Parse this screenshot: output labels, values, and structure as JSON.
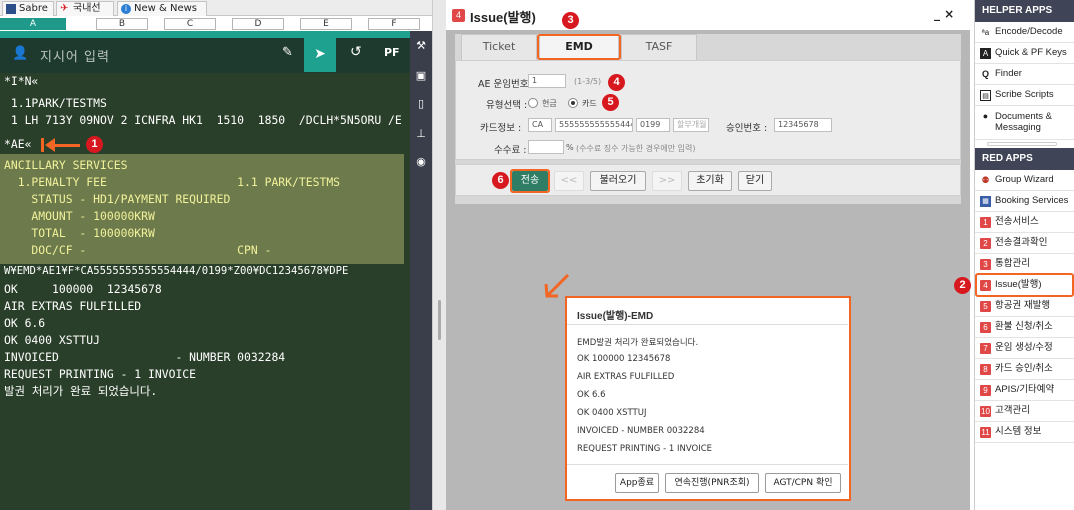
{
  "left": {
    "tabs": [
      "Sabre",
      "국내선",
      "New & News"
    ],
    "areas": [
      "A",
      "B",
      "C",
      "D",
      "E",
      "F"
    ],
    "command_placeholder": "지시어 입력",
    "pf_label": "PF",
    "lines": [
      "*I*N«",
      " 1.1PARK/TESTMS",
      " 1 LH 713Y 09NOV 2 ICNFRA HK1  1510  1850  /DCLH*5N5ORU /E",
      "*AE«"
    ],
    "highlight_lines": [
      "ANCILLARY SERVICES",
      "  1.PENALTY FEE                   1.1 PARK/TESTMS",
      "    STATUS - HD1/PAYMENT REQUIRED",
      "    AMOUNT - 100000KRW",
      "    TOTAL  - 100000KRW",
      "    DOC/CF -                      CPN -"
    ],
    "lower_lines": [
      "W¥EMD*AE1¥F*CA5555555555554444/0199*Z00¥DC12345678¥DPE",
      "OK     100000  12345678",
      "AIR EXTRAS FULFILLED",
      "OK 6.6",
      "OK 0400 XSTTUJ",
      "INVOICED                 - NUMBER 0032284",
      "REQUEST PRINTING - 1 INVOICE",
      "발권 처리가 완료 되었습니다."
    ]
  },
  "mid": {
    "title_num": "4",
    "title": "Issue(발행)",
    "close": "_ ×",
    "tabs": [
      "Ticket",
      "EMD",
      "TASF"
    ],
    "ae_label": "AE 운임번호 :",
    "ae_value": "1",
    "ae_hint": "(1-3/5)",
    "type_label": "유형선택 :",
    "type_cash": "현금",
    "type_card": "카드",
    "card_label": "카드정보 :",
    "card_type": "CA",
    "card_number": "5555555555554444",
    "card_exp": "0199",
    "card_extra": "할부개월",
    "approval_label": "승인번호 :",
    "approval_value": "12345678",
    "fee_label": "수수료 :",
    "fee_unit": "%",
    "fee_hint": "(수수료 징수 가능한 경우에만 입력)",
    "buttons": [
      "전송",
      "<<",
      "불러오기",
      ">>",
      "초기화",
      "닫기"
    ]
  },
  "dialog": {
    "title": "Issue(발행)-EMD",
    "lines": [
      "EMD발권 처리가 완료되었습니다.",
      "OK 100000 12345678",
      "AIR EXTRAS FULFILLED",
      "OK 6.6",
      "OK 0400 XSTTUJ",
      "INVOICED - NUMBER 0032284",
      "REQUEST PRINTING - 1 INVOICE"
    ],
    "buttons": [
      "App종료",
      "연속진행(PNR조회)",
      "AGT/CPN 확인"
    ]
  },
  "helper": {
    "title": "HELPER APPS",
    "items": [
      "Encode/Decode",
      "Quick & PF Keys",
      "Finder",
      "Scribe Scripts",
      "Documents & Messaging"
    ],
    "icons": [
      "ab-icon",
      "keyboard-icon",
      "search-icon",
      "script-icon",
      "pin-icon"
    ]
  },
  "red": {
    "title": "RED APPS",
    "items": [
      "Group Wizard",
      "Booking Services"
    ],
    "numbered": [
      {
        "n": "1",
        "label": "전송서비스"
      },
      {
        "n": "2",
        "label": "전송결과확인"
      },
      {
        "n": "3",
        "label": "통합관리"
      },
      {
        "n": "4",
        "label": "Issue(발행)"
      },
      {
        "n": "5",
        "label": "항공권 재발행"
      },
      {
        "n": "6",
        "label": "환불 신청/취소"
      },
      {
        "n": "7",
        "label": "운임 생성/수정"
      },
      {
        "n": "8",
        "label": "카드 승인/취소"
      },
      {
        "n": "9",
        "label": "APIS/기타예약"
      },
      {
        "n": "10",
        "label": "고객관리"
      },
      {
        "n": "11",
        "label": "시스템 정보"
      }
    ]
  },
  "callouts": [
    "1",
    "2",
    "3",
    "4",
    "5",
    "6"
  ],
  "colors": {
    "accent": "#f26522",
    "badge": "#d7191f",
    "terminal": "#2a3f2a",
    "highlight": "#6d7a4c",
    "teal": "#1fa18f"
  }
}
